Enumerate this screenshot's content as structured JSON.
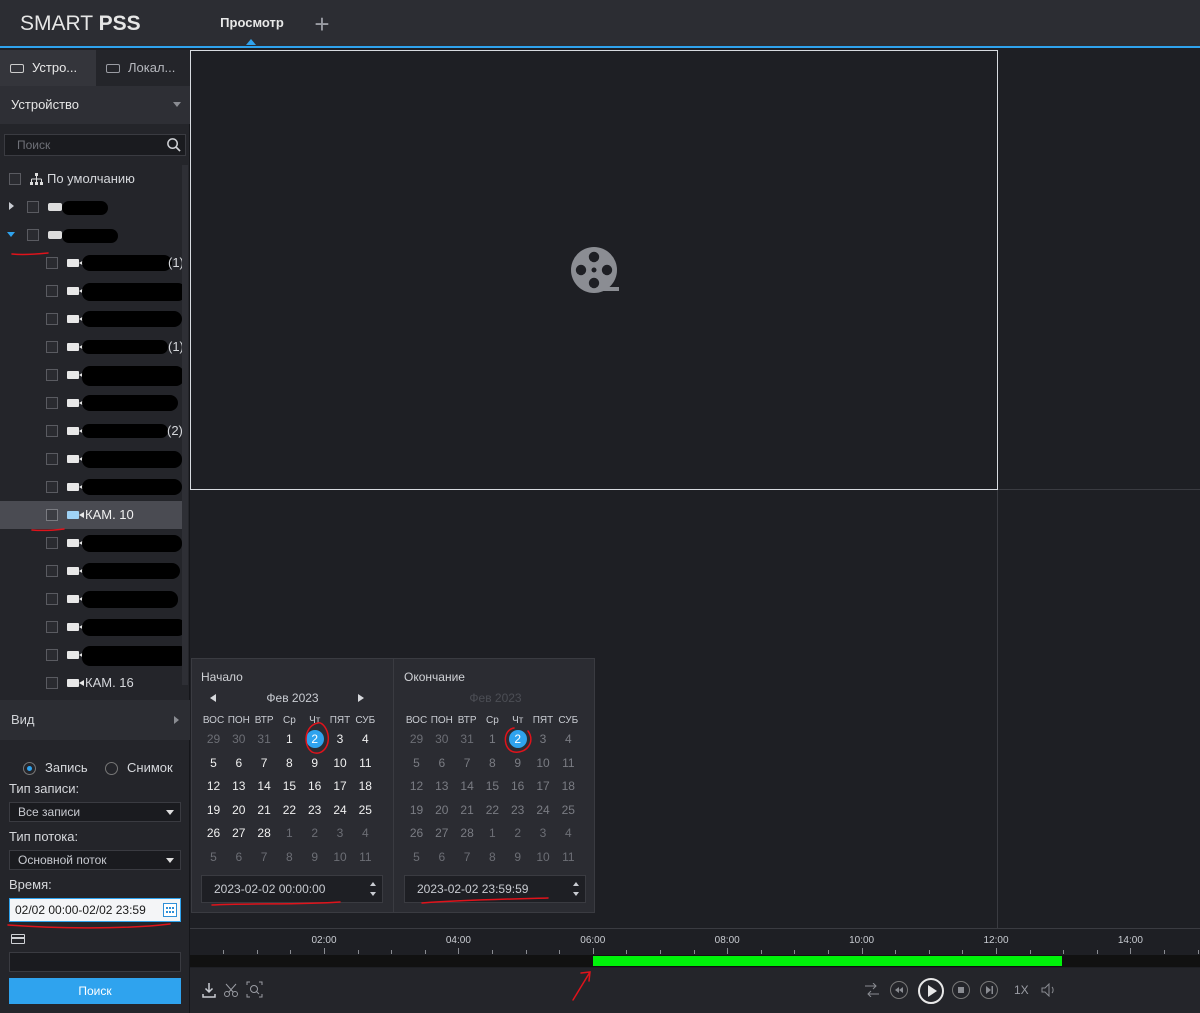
{
  "app": {
    "brand_light": "SMART",
    "brand_bold": "PSS"
  },
  "header": {
    "tab_label": "Просмотр",
    "add_tab": "+"
  },
  "left_tabs": [
    {
      "label": "Устро..."
    },
    {
      "label": "Локал..."
    }
  ],
  "device_select": {
    "label": "Устройство"
  },
  "search": {
    "placeholder": "Поиск"
  },
  "tree": {
    "root_label": "По умолчанию",
    "selected_camera": "КАМ. 10",
    "last_camera": "КАМ. 16",
    "suffix_1": "(1)",
    "suffix_2": "(2)"
  },
  "view_section": {
    "label": "Вид"
  },
  "mode": {
    "record": "Запись",
    "snapshot": "Снимок",
    "selected": "record"
  },
  "filters": {
    "record_type_label": "Тип записи:",
    "record_type_value": "Все записи",
    "stream_type_label": "Тип потока:",
    "stream_type_value": "Основной поток",
    "time_label": "Время:",
    "time_value": "02/02 00:00-02/02 23:59"
  },
  "search_button": {
    "label": "Поиск"
  },
  "calendar": {
    "start": {
      "title": "Начало",
      "month": "Фев  2023",
      "datetime": "2023-02-02 00:00:00"
    },
    "end": {
      "title": "Окончание",
      "month": "Фев  2023",
      "datetime": "2023-02-02 23:59:59"
    },
    "weekdays": [
      "ВОС",
      "ПОН",
      "ВТР",
      "Ср",
      "Чт",
      "ПЯТ",
      "СУБ"
    ],
    "weeks": [
      [
        "29",
        "30",
        "31",
        "1",
        "2",
        "3",
        "4"
      ],
      [
        "5",
        "6",
        "7",
        "8",
        "9",
        "10",
        "11"
      ],
      [
        "12",
        "13",
        "14",
        "15",
        "16",
        "17",
        "18"
      ],
      [
        "19",
        "20",
        "21",
        "22",
        "23",
        "24",
        "25"
      ],
      [
        "26",
        "27",
        "28",
        "1",
        "2",
        "3",
        "4"
      ],
      [
        "5",
        "6",
        "7",
        "8",
        "9",
        "10",
        "11"
      ]
    ],
    "selected_day": "2"
  },
  "timeline": {
    "labels": [
      "02:00",
      "04:00",
      "06:00",
      "08:00",
      "10:00",
      "12:00",
      "14:00"
    ],
    "recording": {
      "start_hour": 6.0,
      "end_hour": 12.98
    }
  },
  "playback": {
    "speed": "1X"
  },
  "colors": {
    "accent": "#2fa3ee",
    "recording": "#00f20a",
    "annotation": "#e0131b"
  }
}
